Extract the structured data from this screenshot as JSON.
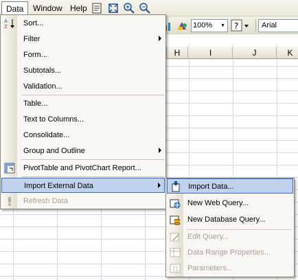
{
  "menubar": {
    "data": "Data",
    "window": "Window",
    "help": "Help"
  },
  "toolbar": {
    "zoom": "100%",
    "font": "Arial"
  },
  "columns": [
    "H",
    "I",
    "J",
    "K"
  ],
  "data_menu": {
    "sort": "Sort...",
    "filter": "Filter",
    "form": "Form...",
    "subtotals": "Subtotals...",
    "validation": "Validation...",
    "table": "Table...",
    "text_to_columns": "Text to Columns...",
    "consolidate": "Consolidate...",
    "group_outline": "Group and Outline",
    "pivot": "PivotTable and PivotChart Report...",
    "import_external": "Import External Data",
    "refresh": "Refresh Data"
  },
  "import_submenu": {
    "import_data": "Import Data...",
    "new_web_query": "New Web Query...",
    "new_database_query": "New Database Query...",
    "edit_query": "Edit Query...",
    "data_range_properties": "Data Range Properties...",
    "parameters": "Parameters..."
  },
  "colors": {
    "highlight": "#c1d2ee",
    "highlight_border": "#316ac5",
    "disabled_text": "#a5a192"
  }
}
